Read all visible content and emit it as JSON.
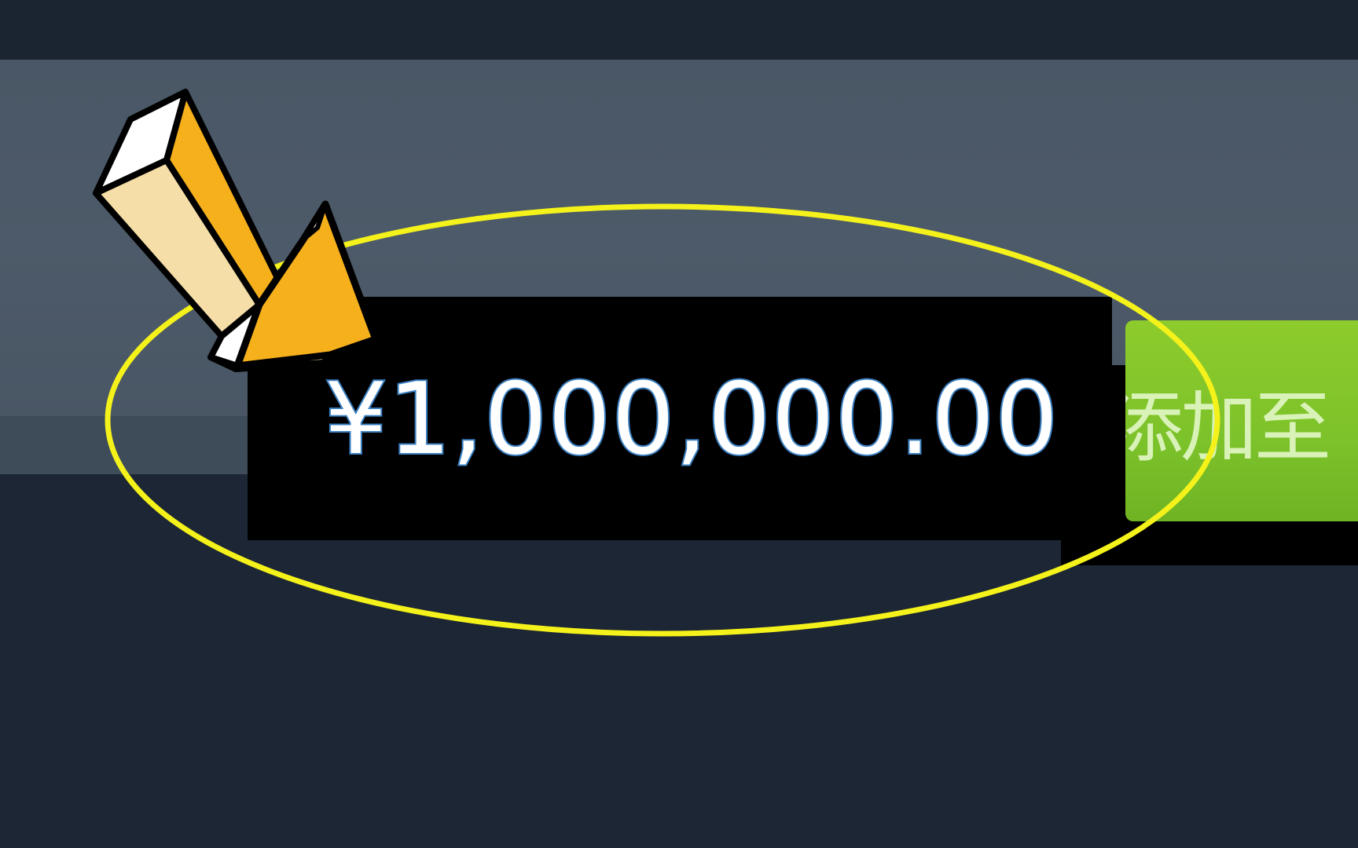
{
  "price": {
    "amount": "¥1,000,000.00"
  },
  "cart_button": {
    "label": "添加至"
  },
  "annotation": {
    "ellipse_icon": "highlight-ellipse",
    "arrow_icon": "pointer-arrow",
    "ellipse_color": "#f4f21a",
    "arrow_color": "#f5b01c"
  },
  "colors": {
    "background": "#1c2634",
    "banner": "#4a5766",
    "price_box": "#000000",
    "price_text_outline": "#3a7fc1",
    "cart_green": "#7cc22a"
  }
}
